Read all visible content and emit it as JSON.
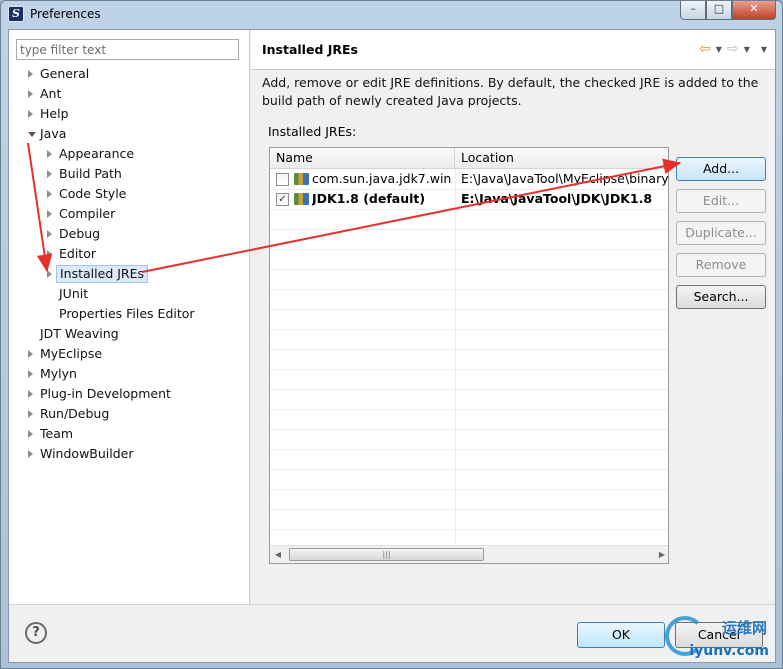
{
  "window": {
    "title": "Preferences",
    "buttons": {
      "minimize": "–",
      "maximize": "□",
      "close": "✕"
    }
  },
  "filter": {
    "placeholder": "type filter text",
    "value": ""
  },
  "tree": {
    "items": [
      {
        "label": "General",
        "expandable": true,
        "level": 0
      },
      {
        "label": "Ant",
        "expandable": true,
        "level": 0
      },
      {
        "label": "Help",
        "expandable": true,
        "level": 0
      },
      {
        "label": "Java",
        "expandable": true,
        "expanded": true,
        "level": 0
      },
      {
        "label": "Appearance",
        "expandable": true,
        "level": 1
      },
      {
        "label": "Build Path",
        "expandable": true,
        "level": 1
      },
      {
        "label": "Code Style",
        "expandable": true,
        "level": 1
      },
      {
        "label": "Compiler",
        "expandable": true,
        "level": 1
      },
      {
        "label": "Debug",
        "expandable": true,
        "level": 1
      },
      {
        "label": "Editor",
        "expandable": true,
        "level": 1
      },
      {
        "label": "Installed JREs",
        "expandable": true,
        "level": 1,
        "selected": true
      },
      {
        "label": "JUnit",
        "expandable": false,
        "level": 1
      },
      {
        "label": "Properties Files Editor",
        "expandable": false,
        "level": 1
      },
      {
        "label": "JDT Weaving",
        "expandable": false,
        "level": 0
      },
      {
        "label": "MyEclipse",
        "expandable": true,
        "level": 0
      },
      {
        "label": "Mylyn",
        "expandable": true,
        "level": 0
      },
      {
        "label": "Plug-in Development",
        "expandable": true,
        "level": 0
      },
      {
        "label": "Run/Debug",
        "expandable": true,
        "level": 0
      },
      {
        "label": "Team",
        "expandable": true,
        "level": 0
      },
      {
        "label": "WindowBuilder",
        "expandable": true,
        "level": 0
      }
    ]
  },
  "page": {
    "title": "Installed JREs",
    "description": "Add, remove or edit JRE definitions. By default, the checked JRE is added to the build path of newly created Java projects.",
    "section_label": "Installed JREs:",
    "table": {
      "columns": [
        "Name",
        "Location"
      ],
      "rows": [
        {
          "name": "com.sun.java.jdk7.win...",
          "location": "E:\\Java\\JavaTool\\MyEclipse\\binary\\",
          "checked": false,
          "default": false
        },
        {
          "name": "JDK1.8 (default)",
          "location": "E:\\Java\\JavaTool\\JDK\\JDK1.8",
          "checked": true,
          "default": true
        }
      ]
    },
    "buttons": {
      "add": "Add...",
      "edit": "Edit...",
      "duplicate": "Duplicate...",
      "remove": "Remove",
      "search": "Search..."
    }
  },
  "footer": {
    "help": "?",
    "ok": "OK",
    "cancel": "Cancel"
  },
  "watermark": {
    "chinese": "运维网",
    "url": "iyunv.com"
  },
  "colors": {
    "annotation_arrow": "#e8302a",
    "selection": "#dbe9f8",
    "accent": "#3c7fb1"
  }
}
